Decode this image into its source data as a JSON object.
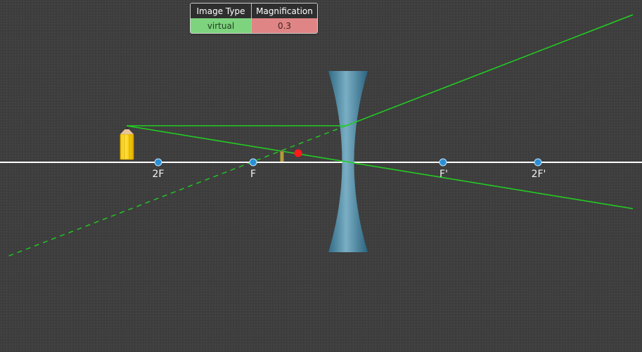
{
  "table": {
    "header_type": "Image Type",
    "header_magnification": "Magnification",
    "image_type": "virtual",
    "magnification": "0.3"
  },
  "labels": {
    "two_f": "2F",
    "f": "F",
    "f_prime": "F'",
    "two_f_prime": "2F'"
  },
  "colors": {
    "background": "#3d3d3d",
    "axis": "#ffffff",
    "ray": "#22cc22",
    "focal_point": "#2a8fd6",
    "lens": "#4a8fb0",
    "object_pencil": "#f5d21c",
    "image_marker": "#ff1a1a",
    "type_cell": "#7ed47e",
    "magnification_cell": "#e08585"
  },
  "icons": {
    "object": "pencil-icon",
    "image": "virtual-image-marker"
  }
}
